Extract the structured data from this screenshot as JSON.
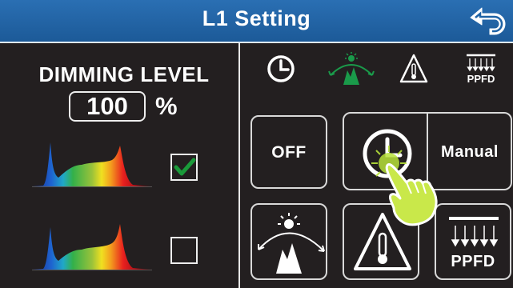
{
  "header": {
    "title": "L1 Setting",
    "back_icon": "back-arrow-icon"
  },
  "dimming": {
    "label": "DIMMING LEVEL",
    "value": "100",
    "unit": "%"
  },
  "spectra": [
    {
      "name": "spectrum-1",
      "checked": true
    },
    {
      "name": "spectrum-2",
      "checked": false
    }
  ],
  "tabs": [
    {
      "icon": "clock-icon",
      "active": false
    },
    {
      "icon": "sunrise-sunset-icon",
      "active": true
    },
    {
      "icon": "temperature-warning-icon",
      "active": false
    },
    {
      "icon": "ppfd-icon",
      "label": "PPFD",
      "active": false
    }
  ],
  "modes": {
    "off_label": "OFF",
    "manual_label": "Manual",
    "ppfd_label": "PPFD",
    "tab_ppfd_label": "PPFD"
  },
  "colors": {
    "header": "#1f63a6",
    "background": "#231f20",
    "active_green": "#1a9a4a",
    "check_green": "#1a9a3a"
  }
}
